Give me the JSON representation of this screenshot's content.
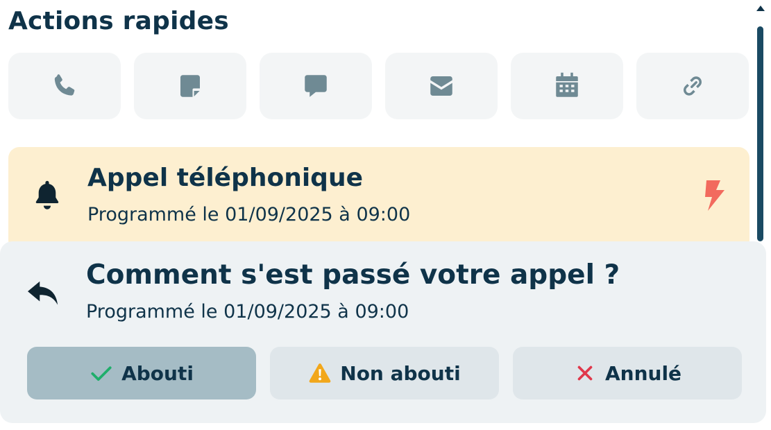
{
  "quick_actions": {
    "title": "Actions rapides",
    "buttons": [
      {
        "icon": "phone-icon"
      },
      {
        "icon": "note-icon"
      },
      {
        "icon": "chat-icon"
      },
      {
        "icon": "mail-icon"
      },
      {
        "icon": "calendar-icon"
      },
      {
        "icon": "link-icon"
      }
    ]
  },
  "notice": {
    "icon": "bell-icon",
    "title": "Appel téléphonique",
    "subtitle": "Programmé le 01/09/2025 à 09:00",
    "badge_icon": "bolt-icon",
    "background": "#fdefd0",
    "badge_color": "#f26a5e"
  },
  "feedback": {
    "icon": "reply-icon",
    "title": "Comment s'est passé votre appel ?",
    "subtitle": "Programmé le 01/09/2025 à 09:00",
    "options": [
      {
        "label": "Abouti",
        "icon": "check-icon",
        "icon_color": "#1fae6b",
        "selected": true
      },
      {
        "label": "Non abouti",
        "icon": "warning-icon",
        "icon_color": "#f2a71b",
        "selected": false
      },
      {
        "label": "Annulé",
        "icon": "close-icon",
        "icon_color": "#e0384b",
        "selected": false
      }
    ]
  },
  "colors": {
    "primary_text": "#0f3349",
    "tile_bg": "#f3f5f6",
    "icon_gray": "#6f8a94",
    "panel_bg": "#eef2f4",
    "selected_bg": "#a5bcc5",
    "button_bg": "#dfe6ea"
  }
}
